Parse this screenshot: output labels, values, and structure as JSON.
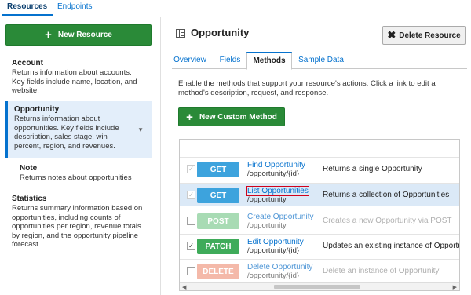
{
  "top_tabs": [
    {
      "label": "Resources",
      "active": true
    },
    {
      "label": "Endpoints",
      "active": false
    }
  ],
  "sidebar": {
    "new_resource_label": "New Resource",
    "items": [
      {
        "name": "Account",
        "desc": "Returns information about accounts. Key fields include name, location, and website."
      },
      {
        "name": "Opportunity",
        "desc": "Returns information about opportunities. Key fields include description, sales stage, win percent, region, and revenues."
      },
      {
        "name": "Note",
        "desc": "Returns notes about opportunities"
      },
      {
        "name": "Statistics",
        "desc": "Returns summary information based on opportunities, including counts of opportunities per region, revenue totals by region, and the opportunity pipeline forecast."
      }
    ]
  },
  "header": {
    "title": "Opportunity",
    "delete_label": "Delete Resource"
  },
  "tabs": [
    {
      "label": "Overview"
    },
    {
      "label": "Fields"
    },
    {
      "label": "Methods"
    },
    {
      "label": "Sample Data"
    }
  ],
  "methods_panel": {
    "intro": "Enable the methods that support your resource's actions. Click a link to edit a method's description, request, and response.",
    "new_custom_label": "New Custom Method",
    "rows": [
      {
        "verb": "GET",
        "name": "Find Opportunity",
        "path": "/opportunity/{id}",
        "desc": "Returns a single Opportunity",
        "checked": true
      },
      {
        "verb": "GET",
        "name": "List Opportunities",
        "path": "/opportunity",
        "desc": "Returns a collection of Opportunities",
        "checked": true
      },
      {
        "verb": "POST",
        "name": "Create Opportunity",
        "path": "/opportunity",
        "desc": "Creates a new Opportunity via POST",
        "checked": false
      },
      {
        "verb": "PATCH",
        "name": "Edit Opportunity",
        "path": "/opportunity/{id}",
        "desc": "Updates an existing instance of Opportunity",
        "checked": true
      },
      {
        "verb": "DELETE",
        "name": "Delete Opportunity",
        "path": "/opportunity/{id}",
        "desc": "Delete an instance of Opportunity",
        "checked": false
      }
    ]
  },
  "icons": {
    "plus": "plus-icon",
    "delete": "close-icon",
    "title": "resource-icon",
    "expand": "chevron-down-icon"
  },
  "colors": {
    "accent": "#0572ce",
    "primary_button": "#2a8a38",
    "get": "#3da3dd",
    "patch": "#3fab5a",
    "post_disabled": "#a8dbb4",
    "delete_disabled": "#f4b9a9",
    "highlight_outline": "#d0021b"
  }
}
